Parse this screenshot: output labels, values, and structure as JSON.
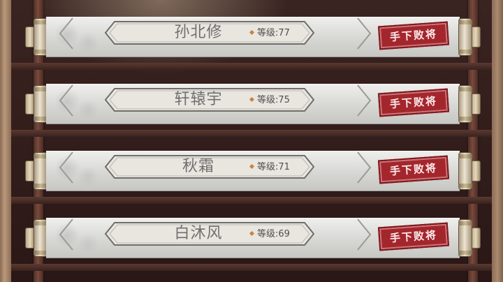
{
  "rows": [
    {
      "name": "孙北修",
      "level_label": "等级:",
      "level_value": "77",
      "stamp": "手下败将"
    },
    {
      "name": "轩辕宇",
      "level_label": "等级:",
      "level_value": "75",
      "stamp": "手下败将"
    },
    {
      "name": "秋霜",
      "level_label": "等级:",
      "level_value": "71",
      "stamp": "手下败将"
    },
    {
      "name": "白沐风",
      "level_label": "等级:",
      "level_value": "69",
      "stamp": "手下败将"
    }
  ],
  "colors": {
    "stamp": "#a4262d",
    "level_diamond": "#c9823f",
    "cabinet": "#2b1817",
    "paper": "#e2e2df"
  }
}
